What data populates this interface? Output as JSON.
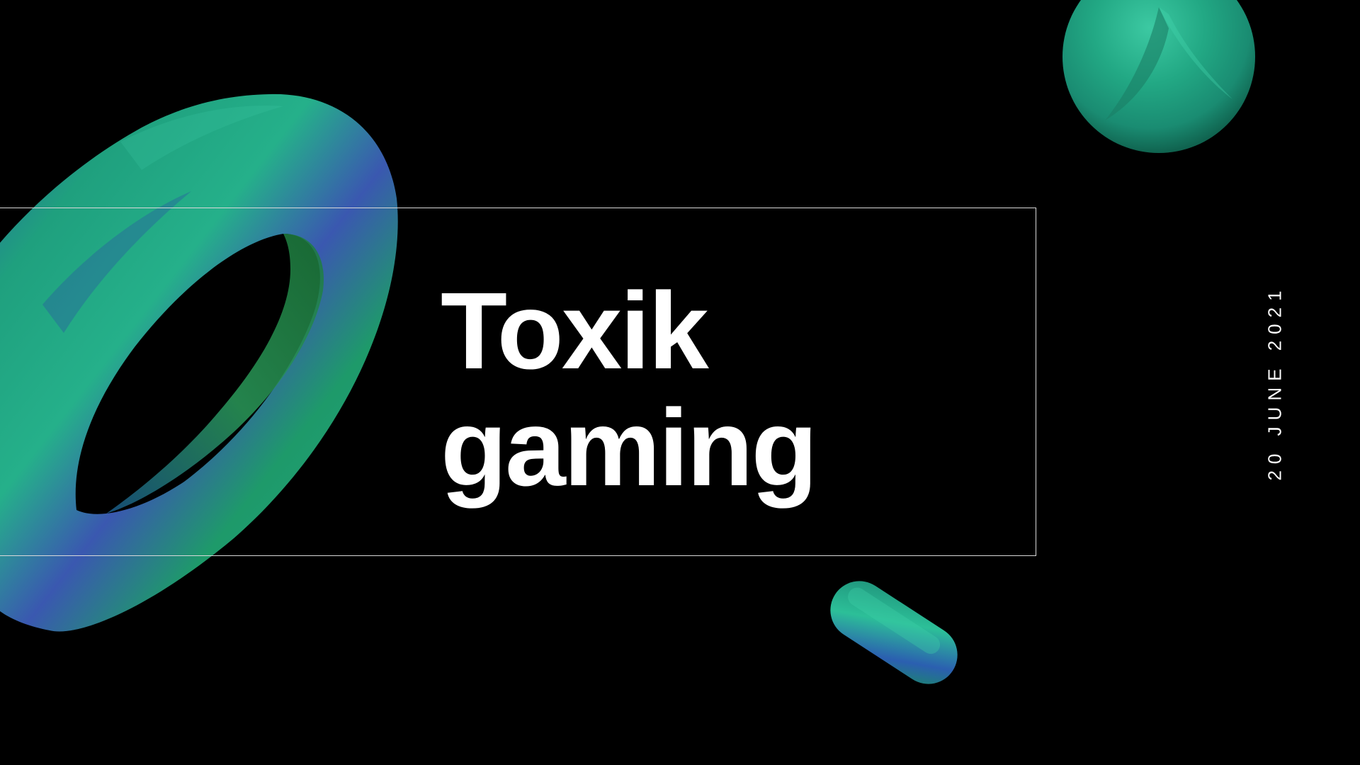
{
  "slide": {
    "title_line1": "Toxik",
    "title_line2": "gaming",
    "date": "20 JUNE 2021"
  },
  "colors": {
    "background": "#000000",
    "text": "#ffffff",
    "frame": "#d9d9d9",
    "shape_teal": "#1fa483",
    "shape_blue": "#2a4fa6",
    "shape_green": "#1f8f4a"
  },
  "icons": [
    "torus-shape",
    "sphere-shape",
    "capsule-shape"
  ]
}
